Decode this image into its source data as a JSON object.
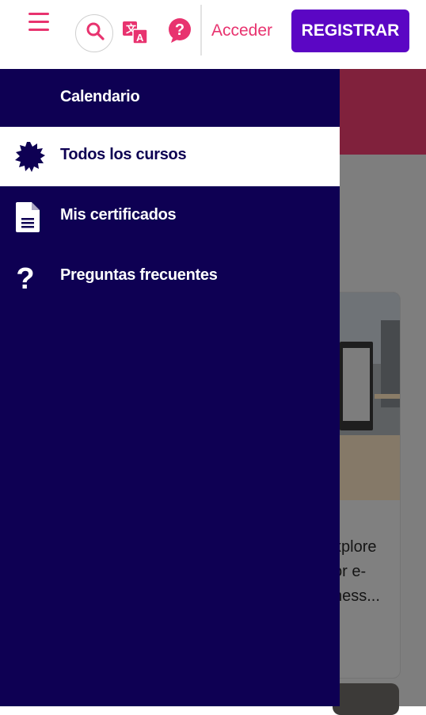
{
  "header": {
    "login_label": "Acceder",
    "register_label": "REGISTRAR",
    "icons": [
      "hamburger-menu-icon",
      "search-icon",
      "translate-icon",
      "help-icon"
    ]
  },
  "drawer": {
    "items": [
      {
        "label": "Calendario",
        "icon": "calendar-icon",
        "active": false
      },
      {
        "label": "Todos los cursos",
        "icon": "badge-icon",
        "active": true
      },
      {
        "label": "Mis certificados",
        "icon": "document-icon",
        "active": false
      },
      {
        "label": "Preguntas frecuentes",
        "icon": "question-icon",
        "active": false
      }
    ]
  },
  "background": {
    "course_card": {
      "description_lines": [
        "xplore",
        "or e-",
        "ness..."
      ]
    }
  },
  "colors": {
    "accent_pink": "#e8336f",
    "primary_purple": "#5b06c4",
    "drawer_navy": "#0e0053",
    "banner": "#80213c"
  }
}
